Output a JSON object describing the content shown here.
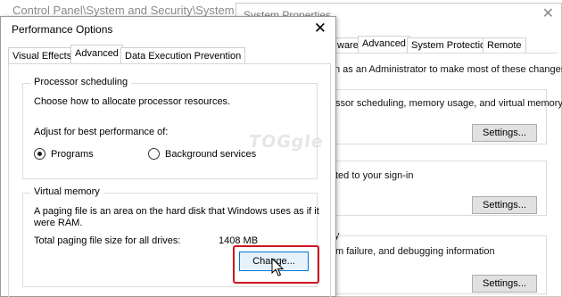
{
  "control_panel": {
    "title": "Control Panel\\System and Security\\System"
  },
  "system_properties": {
    "title": "System Properties",
    "tabs": [
      "ware",
      "Advanced",
      "System Protection",
      "Remote"
    ],
    "admin_text": "n as an Administrator to make most of these changes.",
    "performance_text": "ssor scheduling, memory usage, and virtual memory",
    "profile_text": "ted to your sign-in",
    "startup_fragment": "y",
    "startup_text": "m failure, and debugging information",
    "settings_label": "Settings..."
  },
  "performance_options": {
    "title": "Performance Options",
    "close_glyph": "✕",
    "tabs": [
      "Visual Effects",
      "Advanced",
      "Data Execution Prevention"
    ],
    "processor": {
      "legend": "Processor scheduling",
      "description": "Choose how to allocate processor resources.",
      "adjust_label": "Adjust for best performance of:",
      "options": [
        {
          "label": "Programs",
          "checked": true
        },
        {
          "label": "Background services",
          "checked": false
        }
      ]
    },
    "virtual_memory": {
      "legend": "Virtual memory",
      "description_line1": "A paging file is an area on the hard disk that Windows uses as if it",
      "description_line2": "were RAM.",
      "total_label": "Total paging file size for all drives:",
      "total_value": "1408 MB",
      "change_label": "Change..."
    }
  },
  "watermark_text": "TOGgle",
  "colors": {
    "highlight_border": "#d0141e",
    "focused_button_border": "#0078d7",
    "focused_button_fill": "#e5f1fb"
  }
}
